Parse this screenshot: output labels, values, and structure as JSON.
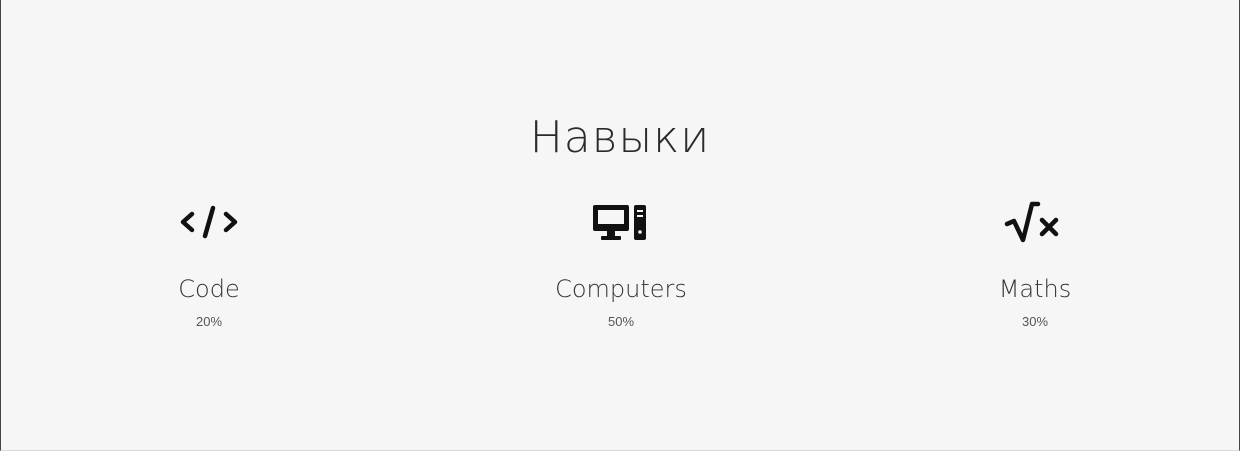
{
  "section": {
    "title": "Навыки",
    "background": "#f6f6f6"
  },
  "skills": [
    {
      "icon": "code-icon",
      "name": "Code",
      "percent": "20%"
    },
    {
      "icon": "desktop-computer-icon",
      "name": "Computers",
      "percent": "50%"
    },
    {
      "icon": "square-root-icon",
      "name": "Maths",
      "percent": "30%"
    }
  ]
}
